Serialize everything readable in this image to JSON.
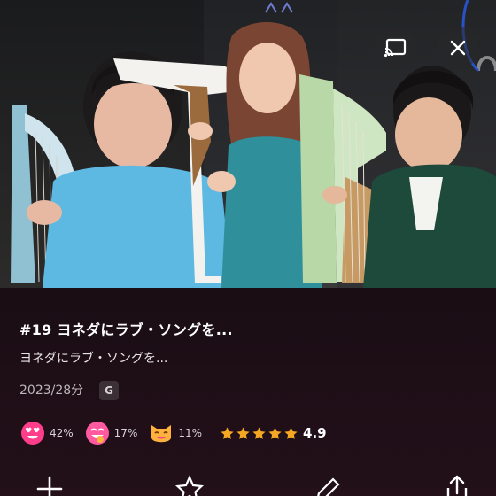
{
  "episode": {
    "title": "#19 ヨネダにラブ・ソングを...",
    "subtitle": "ヨネダにラブ・ソングを...",
    "meta": "2023/28分",
    "rating_badge": "G"
  },
  "reactions": [
    {
      "icon": "heart-eyes-face-icon",
      "percent": "42%"
    },
    {
      "icon": "tongue-face-icon",
      "percent": "17%"
    },
    {
      "icon": "cat-face-icon",
      "percent": "11%"
    }
  ],
  "stars": {
    "count": 5,
    "score": "4.9"
  },
  "colors": {
    "background": "#1e0f17",
    "accent_pink": "#ff3d8a",
    "star": "#f5a623"
  }
}
